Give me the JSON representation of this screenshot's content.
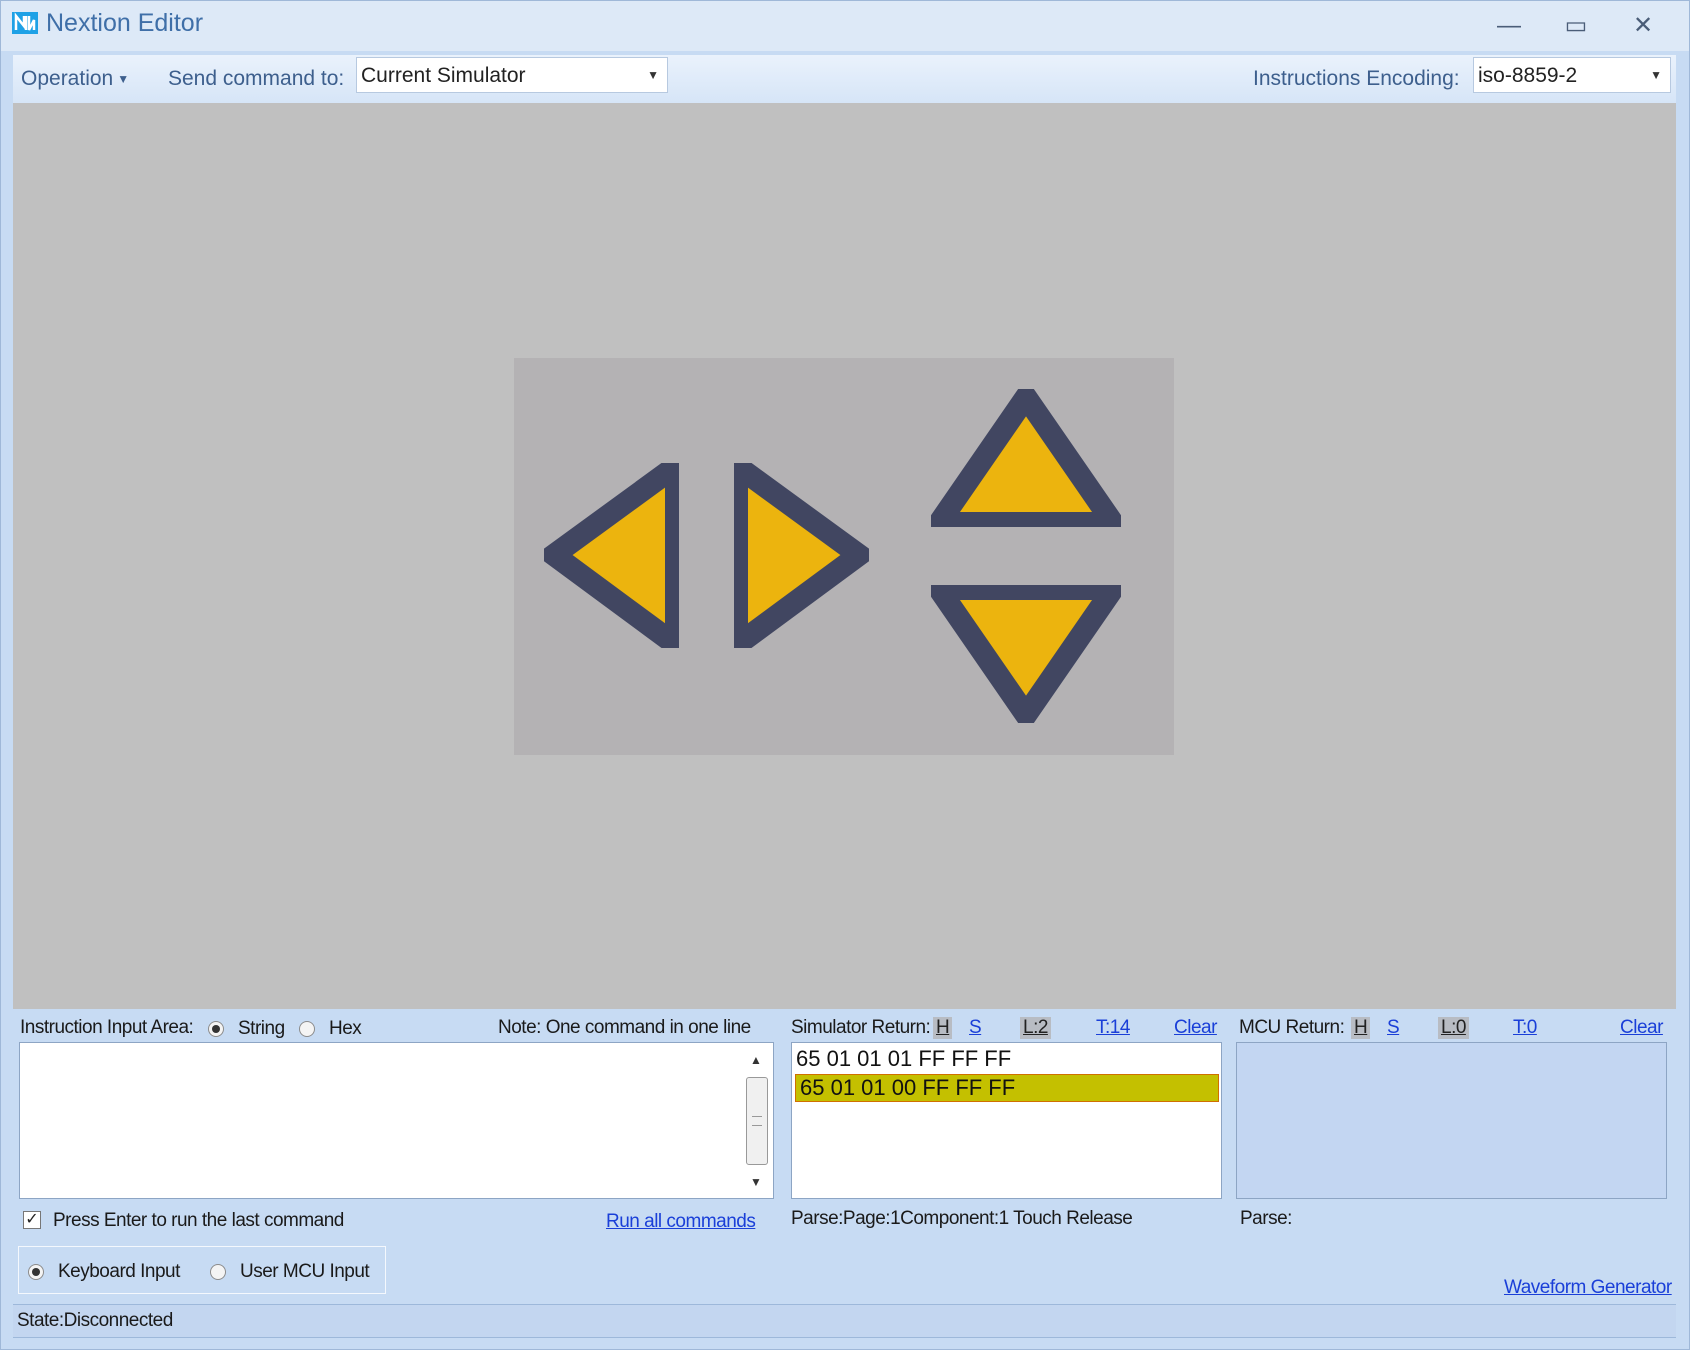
{
  "window": {
    "title": "Nextion Editor",
    "minimize": "—",
    "maximize": "▭",
    "close": "✕"
  },
  "toolbar": {
    "operation_menu": "Operation",
    "send_command_label": "Send command to:",
    "send_command_value": "Current Simulator",
    "encoding_label": "Instructions Encoding:",
    "encoding_value": "iso-8859-2"
  },
  "simulator": {
    "screen_bg": "#b4b2b4",
    "arrow_fill": "#ecb40e",
    "arrow_stroke": "#414661",
    "buttons": [
      "arrow-left",
      "arrow-right",
      "arrow-up",
      "arrow-down"
    ]
  },
  "instruction_input": {
    "label": "Instruction Input Area:",
    "mode_string": "String",
    "mode_hex": "Hex",
    "selected_mode": "String",
    "note": "Note: One command in one line",
    "value": "",
    "press_enter_label": "Press Enter to run the last command",
    "press_enter_checked": true,
    "run_all_link": "Run all commands"
  },
  "input_source": {
    "keyboard": "Keyboard Input",
    "user_mcu": "User MCU Input",
    "selected": "Keyboard Input"
  },
  "simulator_return": {
    "label": "Simulator Return:",
    "h": "H",
    "s": "S",
    "length": "L:2",
    "total": "T:14",
    "clear": "Clear",
    "lines": [
      "65 01 01 01 FF FF FF",
      "65 01 01 00 FF FF FF"
    ],
    "selected_line": 1,
    "parse": "Parse:Page:1Component:1 Touch Release"
  },
  "mcu_return": {
    "label": "MCU Return:",
    "h": "H",
    "s": "S",
    "length": "L:0",
    "total": "T:0",
    "clear": "Clear",
    "parse": "Parse:"
  },
  "waveform_link": "Waveform Generator",
  "status": "State:Disconnected"
}
